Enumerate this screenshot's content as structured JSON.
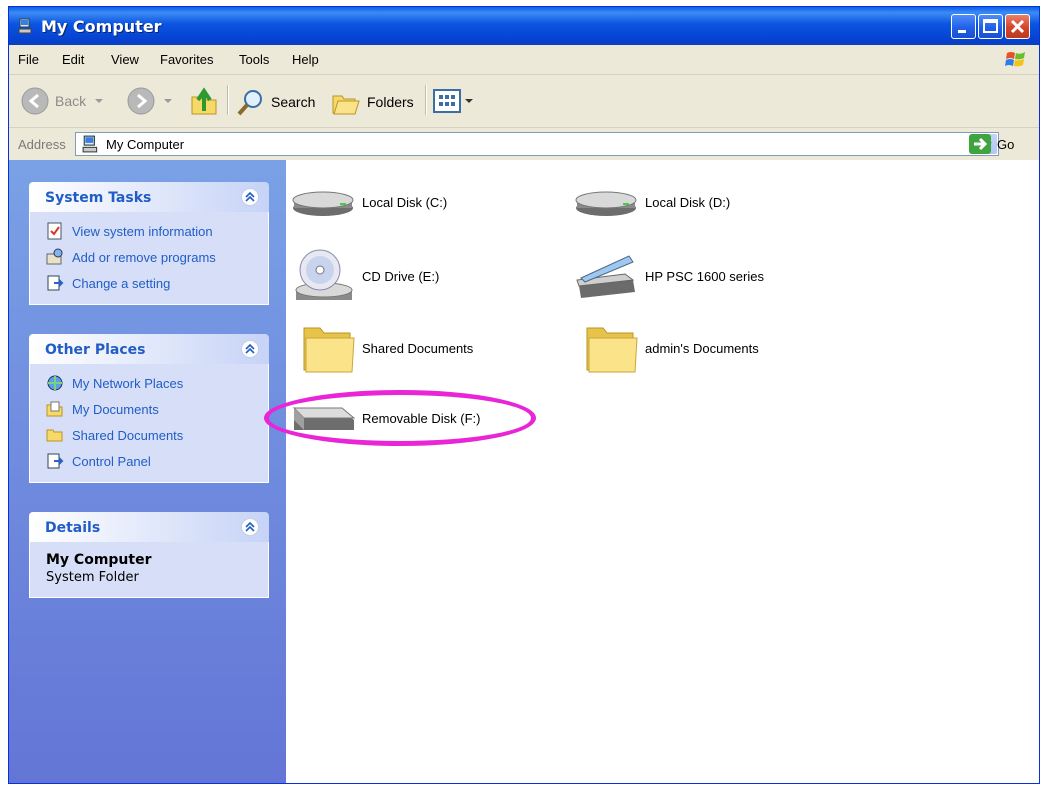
{
  "window": {
    "title": "My Computer"
  },
  "menu": [
    "File",
    "Edit",
    "View",
    "Favorites",
    "Tools",
    "Help"
  ],
  "toolbar": {
    "back": "Back",
    "search": "Search",
    "folders": "Folders"
  },
  "address": {
    "label": "Address",
    "value": "My Computer",
    "go": "Go"
  },
  "system_tasks": {
    "title": "System Tasks",
    "items": [
      "View system information",
      "Add or remove programs",
      "Change a setting"
    ]
  },
  "other_places": {
    "title": "Other Places",
    "items": [
      "My Network Places",
      "My Documents",
      "Shared Documents",
      "Control Panel"
    ]
  },
  "details": {
    "title": "Details",
    "name": "My Computer",
    "type": "System Folder"
  },
  "items": [
    {
      "label": "Local Disk (C:)",
      "icon": "hard-disk-icon"
    },
    {
      "label": "Local Disk (D:)",
      "icon": "hard-disk-icon"
    },
    {
      "label": "CD Drive (E:)",
      "icon": "cd-drive-icon"
    },
    {
      "label": "HP PSC 1600 series",
      "icon": "scanner-icon"
    },
    {
      "label": "Shared Documents",
      "icon": "folder-icon"
    },
    {
      "label": "admin's Documents",
      "icon": "folder-icon"
    },
    {
      "label": "Removable Disk (F:)",
      "icon": "removable-disk-icon"
    }
  ],
  "colors": {
    "titlebar": "#0a54e0",
    "taskpane_bg": "#6375d6",
    "link": "#215dc6",
    "highlight_circle": "#e826d8"
  }
}
